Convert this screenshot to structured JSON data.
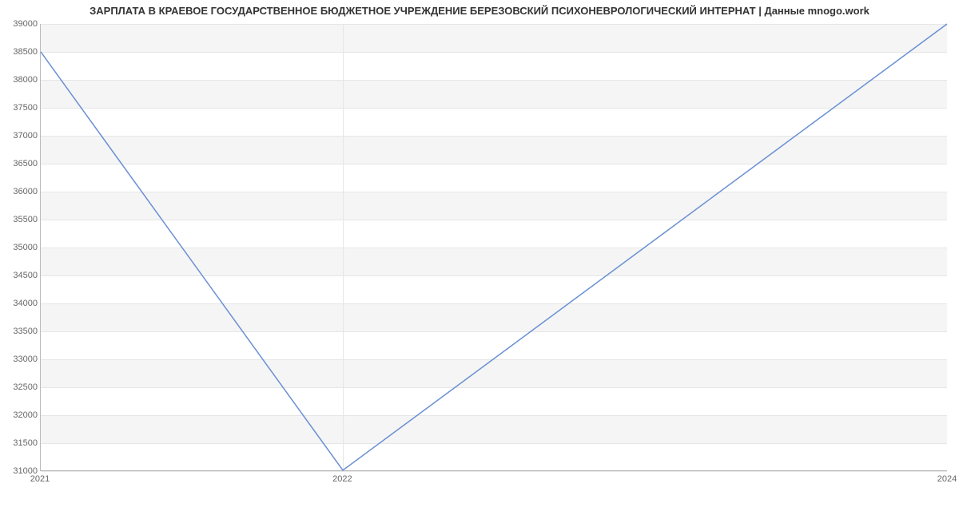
{
  "chart_data": {
    "type": "line",
    "title": "ЗАРПЛАТА В КРАЕВОЕ ГОСУДАРСТВЕННОЕ БЮДЖЕТНОЕ УЧРЕЖДЕНИЕ БЕРЕЗОВСКИЙ ПСИХОНЕВРОЛОГИЧЕСКИЙ ИНТЕРНАТ | Данные mnogo.work",
    "xlabel": "",
    "ylabel": "",
    "x": [
      2021,
      2022,
      2024
    ],
    "values": [
      38500,
      31000,
      39000
    ],
    "xlim": [
      2021,
      2024
    ],
    "ylim": [
      31000,
      39000
    ],
    "xticks": [
      2021,
      2022,
      2024
    ],
    "yticks": [
      31000,
      31500,
      32000,
      32500,
      33000,
      33500,
      34000,
      34500,
      35000,
      35500,
      36000,
      36500,
      37000,
      37500,
      38000,
      38500,
      39000
    ],
    "line_color": "#6a8fd4"
  }
}
